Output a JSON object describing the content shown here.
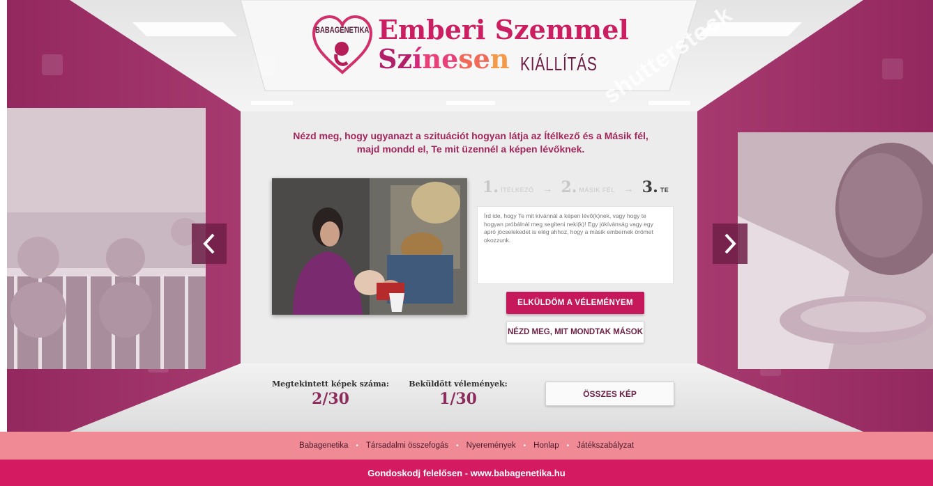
{
  "header": {
    "brand": "BABAGENETIKA",
    "title_line1": "Emberi Szemmel",
    "title_line2_parts": [
      "Sz",
      "í",
      "ne",
      "se",
      "n"
    ],
    "title_line2_suffix": "KIÁLLÍTÁS",
    "watermark": "shutterstock"
  },
  "intro": {
    "line1": "Nézd meg, hogy ugyanazt a szituációt hogyan látja az Ítélkező és a Másik fél,",
    "line2": "majd mondd el, Te mit üzennél a képen lévőknek."
  },
  "steps": [
    {
      "num": "1.",
      "label": "ÍTÉLKEZŐ",
      "active": false
    },
    {
      "num": "2.",
      "label": "MÁSIK FÉL",
      "active": false
    },
    {
      "num": "3.",
      "label": "TE",
      "active": true
    }
  ],
  "step_arrow": "→",
  "opinion": {
    "placeholder": "Írd ide, hogy Te mit kívánnál a képen lévő(k)nek, vagy hogy te hogyan próbálnál meg segíteni neki(k)! Egy jókívánság vagy egy apró jócselekedet is elég ahhoz, hogy a másik embernek örömet okozzunk."
  },
  "buttons": {
    "send": "ELKÜLDÖM A VÉLEMÉNYEM",
    "others": "NÉZD MEG, MIT MONDTAK MÁSOK",
    "all": "ÖSSZES KÉP"
  },
  "stats": {
    "viewed_label": "Megtekintett képek száma:",
    "viewed_value": "2/30",
    "sent_label": "Beküldött vélemények:",
    "sent_value": "1/30"
  },
  "footer": {
    "links": [
      "Babagenetika",
      "Társadalmi összefogás",
      "Nyeremények",
      "Honlap",
      "Játékszabályzat"
    ],
    "separator": "•",
    "tagline": "Gondoskodj felelősen - www.babagenetika.hu"
  },
  "colors": {
    "magenta_wall": "#9b2e67",
    "accent": "#c5195c",
    "footer_light": "#f08a95",
    "footer_dark": "#d41b62"
  }
}
